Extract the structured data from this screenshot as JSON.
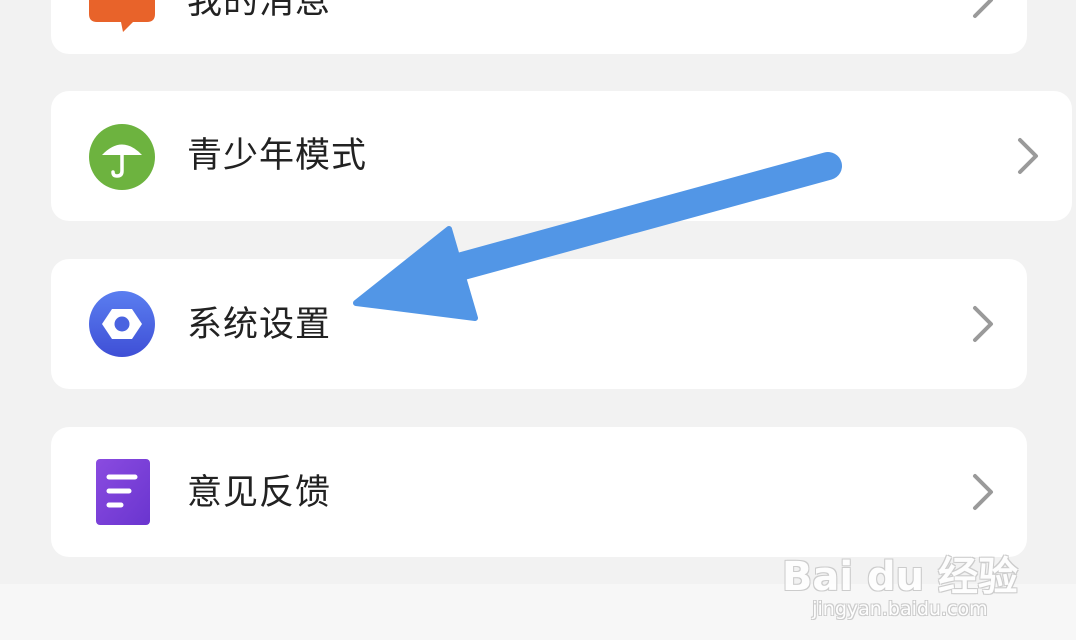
{
  "menu": {
    "items": [
      {
        "label": "我的消息",
        "icon": "message-icon",
        "icon_color": "#e8632a"
      },
      {
        "label": "青少年模式",
        "icon": "umbrella-icon",
        "icon_color": "#6db33f"
      },
      {
        "label": "系统设置",
        "icon": "settings-hexagon-icon",
        "icon_color": "#4a63e0"
      },
      {
        "label": "意见反馈",
        "icon": "feedback-document-icon",
        "icon_color": "#7b3fd8"
      }
    ]
  },
  "annotation": {
    "arrow_color": "#5296e6",
    "arrow_target": "系统设置"
  },
  "watermark": {
    "logo_text": "Bai du 经验",
    "url": "jingyan.baidu.com"
  }
}
